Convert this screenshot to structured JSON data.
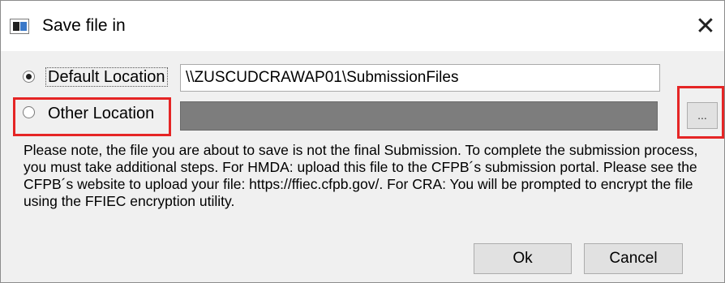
{
  "window": {
    "title": "Save file in",
    "icon": "app-window-icon",
    "close_glyph": "✕"
  },
  "location": {
    "default_label": "Default Location",
    "default_checked": true,
    "default_path": "\\\\ZUSCUDCRAWAP01\\SubmissionFiles",
    "other_label": "Other  Location",
    "other_checked": false,
    "other_path": "",
    "browse_label": "..."
  },
  "note": "Please note, the file you are about to save is not the final Submission. To complete the submission process, you must take additional steps. For HMDA: upload this file to the CFPB´s submission portal. Please see the CFPB´s website to upload your file: https://ffiec.cfpb.gov/. For CRA: You will be prompted to encrypt the file using the FFIEC encryption utility.",
  "buttons": {
    "ok": "Ok",
    "cancel": "Cancel"
  },
  "colors": {
    "highlight": "#e52525",
    "disabled_field": "#7d7d7d",
    "dialog_bg": "#f0f0f0"
  }
}
